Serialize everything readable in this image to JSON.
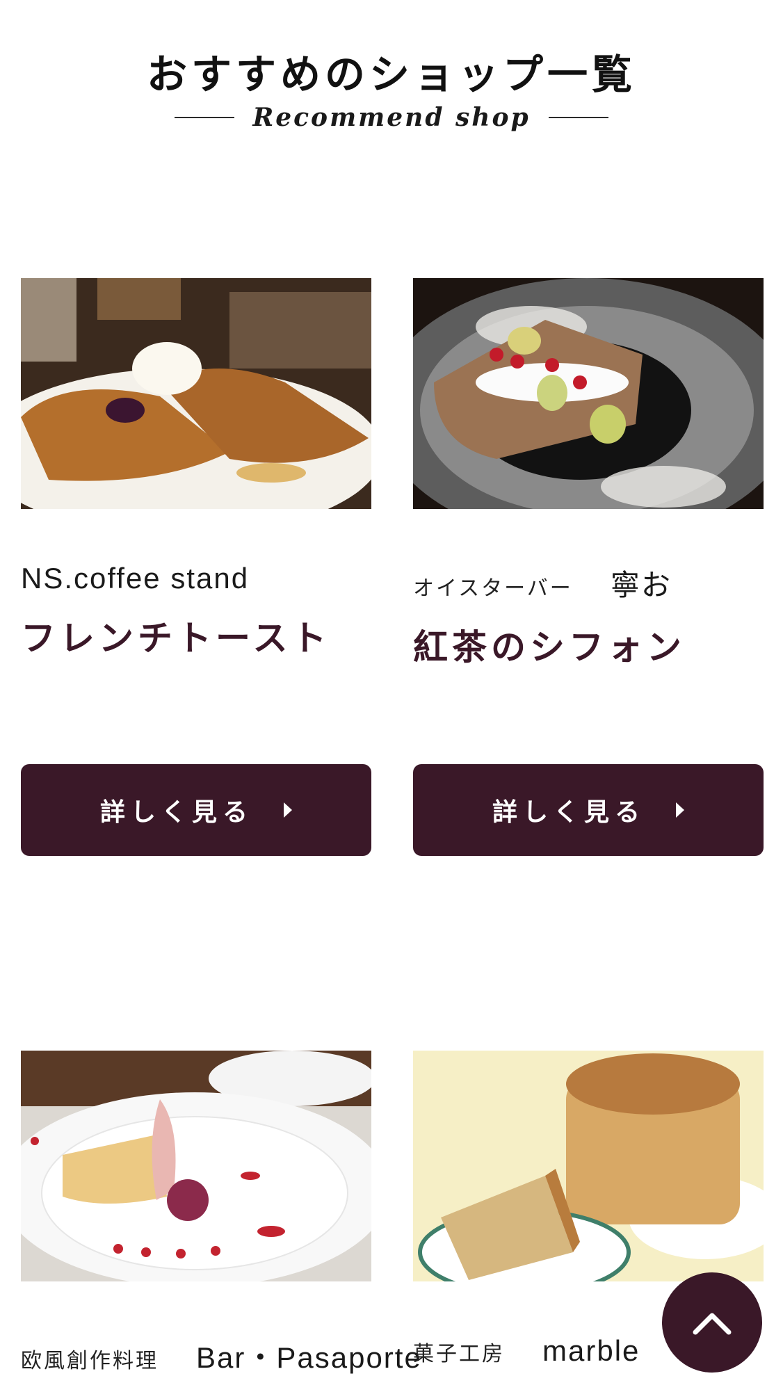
{
  "header": {
    "title": "おすすめのショップ一覧",
    "subtitle": "Recommend shop"
  },
  "colors": {
    "accent": "#3a1828",
    "background": "#ffffff"
  },
  "cards": [
    {
      "photo": "french-toast-photo",
      "shop_genre": "",
      "shop_name": "NS.coffee stand",
      "menu_name": "フレンチトースト",
      "button_label": "詳しく見る"
    },
    {
      "photo": "tea-chiffon-photo",
      "shop_genre": "オイスターバー",
      "shop_name": "寧お",
      "menu_name": "紅茶のシフォン",
      "button_label": "詳しく見る"
    },
    {
      "photo": "cheesecake-plate-photo",
      "shop_genre": "欧風創作料理",
      "shop_name": "Bar・Pasaporte",
      "menu_name": ""
    },
    {
      "photo": "chiffon-cake-photo",
      "shop_genre": "菓子工房",
      "shop_name": "marble",
      "menu_name": ""
    }
  ],
  "scroll_top": {
    "icon": "chevron-up-icon"
  }
}
